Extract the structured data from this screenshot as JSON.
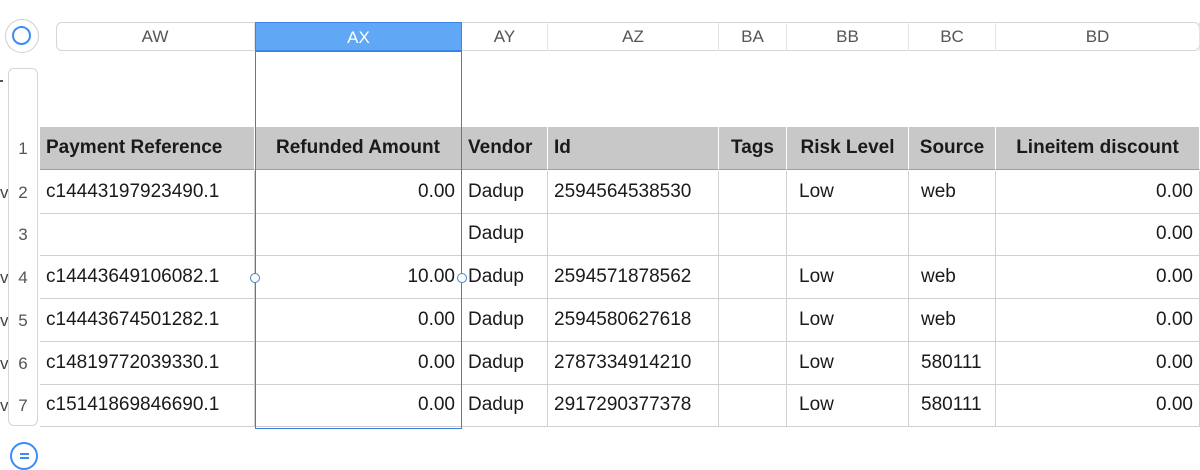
{
  "columns": [
    "AW",
    "AX",
    "AY",
    "AZ",
    "BA",
    "BB",
    "BC",
    "BD"
  ],
  "selected_column": "AX",
  "headers": [
    "Payment Reference",
    "Refunded Amount",
    "Vendor",
    "Id",
    "Tags",
    "Risk Level",
    "Source",
    "Lineitem discount"
  ],
  "header_row_number": "1",
  "rows": [
    {
      "num": "2",
      "cut": "v.",
      "ref": "c14443197923490.1",
      "refund": "0.00",
      "vendor": "Dadup",
      "id": "2594564538530",
      "tags": "",
      "risk": "Low",
      "source": "web",
      "discount": "0.00"
    },
    {
      "num": "3",
      "cut": "",
      "ref": "",
      "refund": "",
      "vendor": "Dadup",
      "id": "",
      "tags": "",
      "risk": "",
      "source": "",
      "discount": "0.00"
    },
    {
      "num": "4",
      "cut": "v.",
      "ref": "c14443649106082.1",
      "refund": "10.00",
      "vendor": "Dadup",
      "id": "2594571878562",
      "tags": "",
      "risk": "Low",
      "source": "web",
      "discount": "0.00"
    },
    {
      "num": "5",
      "cut": "v.",
      "ref": "c14443674501282.1",
      "refund": "0.00",
      "vendor": "Dadup",
      "id": "2594580627618",
      "tags": "",
      "risk": "Low",
      "source": "web",
      "discount": "0.00"
    },
    {
      "num": "6",
      "cut": "v.",
      "ref": "c14819772039330.1",
      "refund": "0.00",
      "vendor": "Dadup",
      "id": "2787334914210",
      "tags": "",
      "risk": "Low",
      "source": "580111",
      "discount": "0.00"
    },
    {
      "num": "7",
      "cut": "v.",
      "ref": "c15141869846690.1",
      "refund": "0.00",
      "vendor": "Dadup",
      "id": "2917290377378",
      "tags": "",
      "risk": "Low",
      "source": "580111",
      "discount": "0.00"
    }
  ],
  "colors": {
    "selection": "#3a7fe0",
    "selected_header": "#60a8f6",
    "header_fill": "#c8c8c8"
  }
}
